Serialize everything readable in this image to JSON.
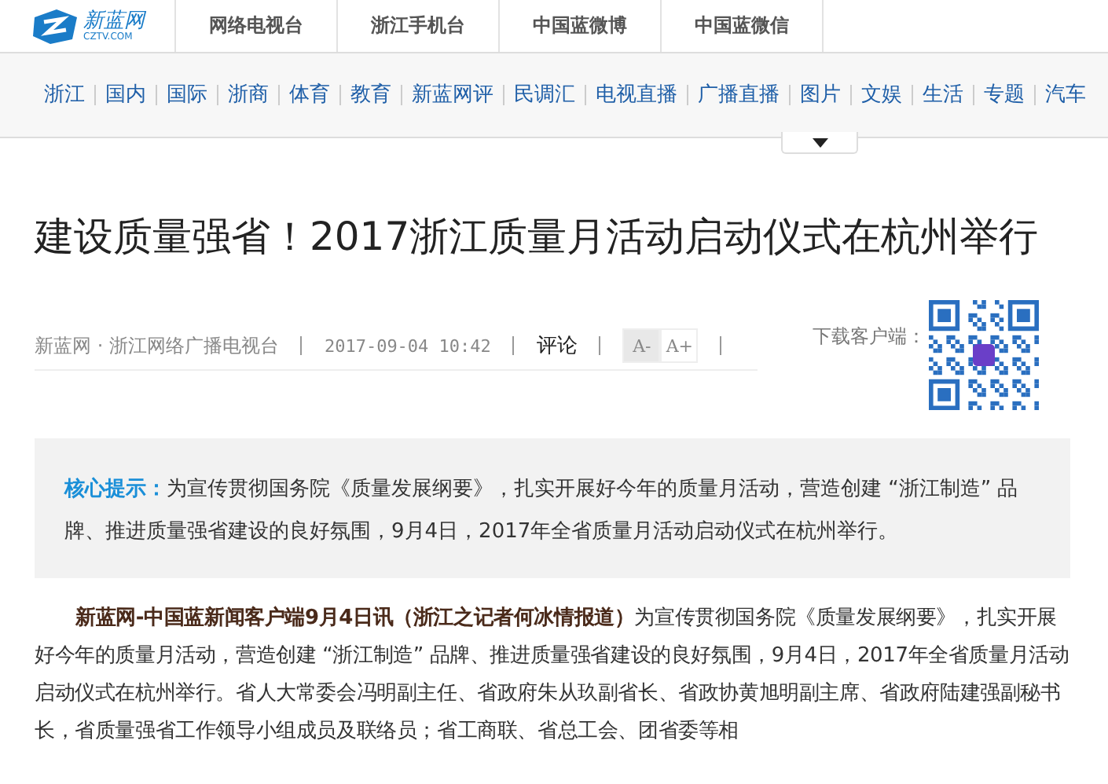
{
  "header": {
    "logo": {
      "name": "新蓝网",
      "domain": "CZTV.COM"
    },
    "tabs": [
      "网络电视台",
      "浙江手机台",
      "中国蓝微博",
      "中国蓝微信"
    ]
  },
  "nav": {
    "items": [
      "浙江",
      "国内",
      "国际",
      "浙商",
      "体育",
      "教育",
      "新蓝网评",
      "民调汇",
      "电视直播",
      "广播直播",
      "图片",
      "文娱",
      "生活",
      "专题",
      "汽车"
    ]
  },
  "article": {
    "title": "建设质量强省！2017浙江质量月活动启动仪式在杭州举行",
    "source": "新蓝网 · 浙江网络广播电视台",
    "date": "2017-09-04 10:42",
    "comment_link": "评论",
    "font_buttons": [
      {
        "label": "A-",
        "selected": true
      },
      {
        "label": "A+",
        "selected": false
      }
    ],
    "download_label": "下载客户端：",
    "summary": "**核心提示：**为宣传贯彻国务院《质量发展纲要》，扎实开展好今年的质量月活动，营造创建 “浙江制造” 品牌、推进质量强省建设的良好氛围，9月4日，2017年全省质量月活动启动仪式在杭州举行。",
    "body": "**新蓝网-中国蓝新闻客户端9月4日讯（浙江之记者何冰情报道）**为宣传贯彻国务院《质量发展纲要》，扎实开展好今年的质量月活动，营造创建 “浙江制造” 品牌、推进质量强省建设的良好氛围，9月4日，2017年全省质量月活动启动仪式在杭州举行。省人大常委会冯明副主任、省政府朱从玖副省长、省政协黄旭明副主席、省政府陆建强副秘书长，省质量强省工作领导小组成员及联络员；省工商联、省总工会、团省委等相"
  }
}
